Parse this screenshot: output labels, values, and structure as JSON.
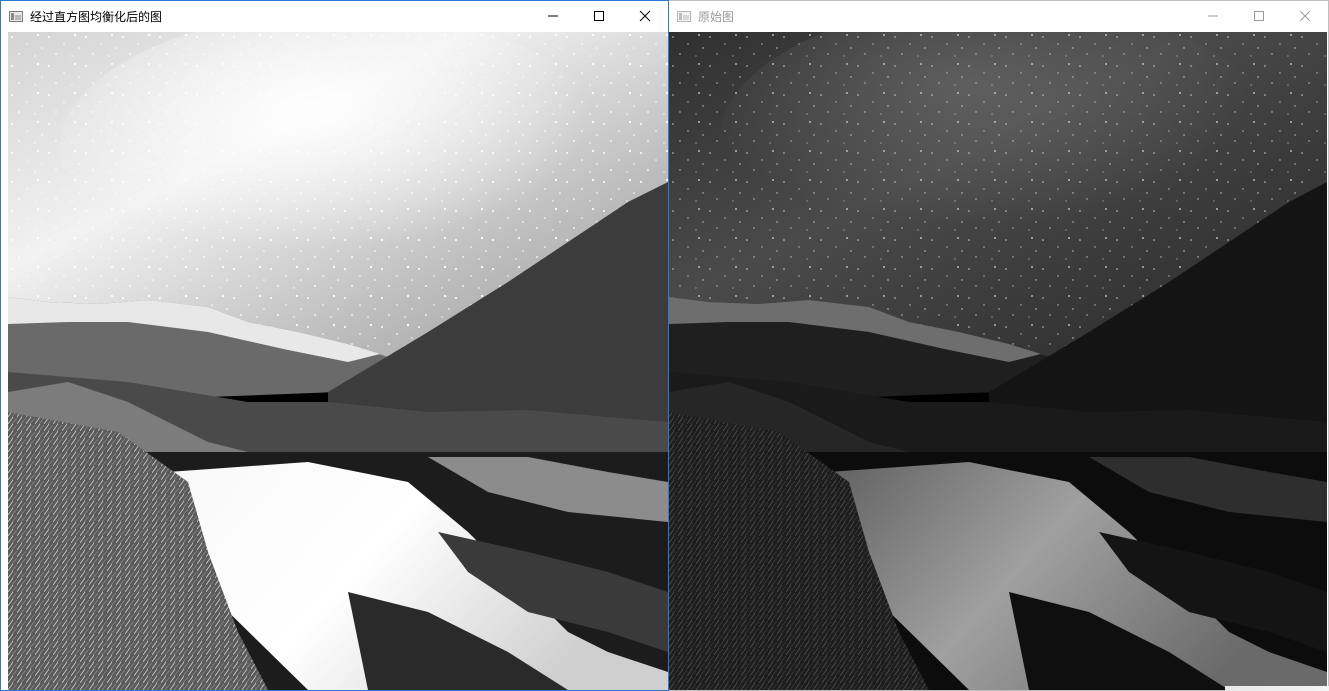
{
  "windows": [
    {
      "title": "经过直方图均衡化后的图",
      "active": true,
      "icon": "opencv-window-icon",
      "image_variant": "equalized"
    },
    {
      "title": "原始图",
      "active": false,
      "icon": "opencv-window-icon",
      "image_variant": "original"
    }
  ],
  "colors": {
    "active_border": "#2b79d0",
    "inactive_border": "#bfbfbf",
    "titlebar_bg": "#ffffff",
    "active_glyph": "#000000",
    "inactive_glyph": "#9a9a9a"
  }
}
